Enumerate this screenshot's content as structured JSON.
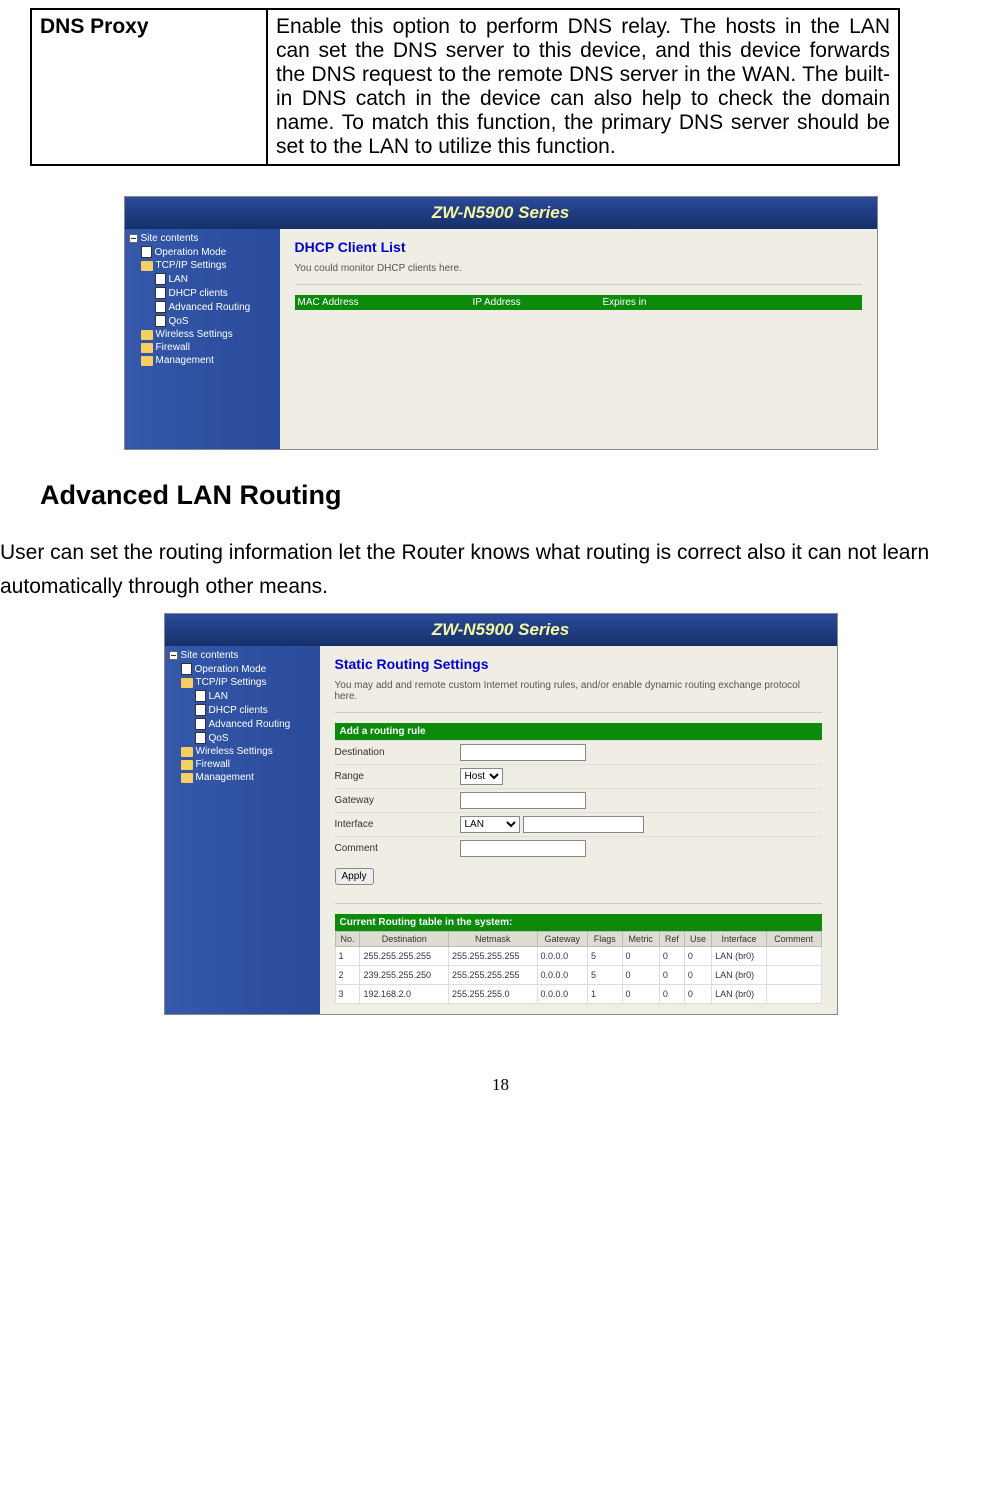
{
  "top_table": {
    "label": "DNS Proxy",
    "text": "Enable this option to perform DNS relay. The hosts in the LAN can set the DNS server to this device, and this device forwards the DNS request to the remote DNS server in the WAN. The built-in DNS catch in the device can also help to check the domain name. To match this function, the primary DNS server should be set to the LAN to utilize this function."
  },
  "screenshot1": {
    "series": "ZW-N5900 Series",
    "sidebar_title": "Site contents",
    "sidebar": {
      "operation_mode": "Operation Mode",
      "tcpip": "TCP/IP Settings",
      "lan": "LAN",
      "dhcp": "DHCP clients",
      "advanced_routing": "Advanced Routing",
      "qos": "QoS",
      "wireless": "Wireless Settings",
      "firewall": "Firewall",
      "management": "Management"
    },
    "content_title": "DHCP Client List",
    "content_sub": "You could monitor DHCP clients here.",
    "table_headers": {
      "mac": "MAC Address",
      "ip": "IP Address",
      "expires": "Expires in"
    }
  },
  "section_heading": "Advanced LAN Routing",
  "body_text": "User can set the routing information let the Router knows what routing is correct also it can not learn automatically through other means.",
  "screenshot2": {
    "series": "ZW-N5900 Series",
    "sidebar_title": "Site contents",
    "sidebar": {
      "operation_mode": "Operation Mode",
      "tcpip": "TCP/IP Settings",
      "lan": "LAN",
      "dhcp": "DHCP clients",
      "advanced_routing": "Advanced Routing",
      "qos": "QoS",
      "wireless": "Wireless Settings",
      "firewall": "Firewall",
      "management": "Management"
    },
    "content_title": "Static Routing Settings",
    "content_sub": "You may add and remote custom Internet routing rules, and/or enable dynamic routing exchange protocol here.",
    "banner_add": "Add a routing rule",
    "form": {
      "destination": "Destination",
      "range": "Range",
      "range_value": "Host",
      "gateway": "Gateway",
      "interface": "Interface",
      "interface_value": "LAN",
      "comment": "Comment"
    },
    "apply": "Apply",
    "banner_current": "Current Routing table in the system:",
    "rt_headers": {
      "no": "No.",
      "destination": "Destination",
      "netmask": "Netmask",
      "gateway": "Gateway",
      "flags": "Flags",
      "metric": "Metric",
      "ref": "Ref",
      "use": "Use",
      "interface": "Interface",
      "comment": "Comment"
    },
    "rt_rows": [
      {
        "no": "1",
        "destination": "255.255.255.255",
        "netmask": "255.255.255.255",
        "gateway": "0.0.0.0",
        "flags": "5",
        "metric": "0",
        "ref": "0",
        "use": "0",
        "interface": "LAN (br0)",
        "comment": ""
      },
      {
        "no": "2",
        "destination": "239.255.255.250",
        "netmask": "255.255.255.255",
        "gateway": "0.0.0.0",
        "flags": "5",
        "metric": "0",
        "ref": "0",
        "use": "0",
        "interface": "LAN (br0)",
        "comment": ""
      },
      {
        "no": "3",
        "destination": "192.168.2.0",
        "netmask": "255.255.255.0",
        "gateway": "0.0.0.0",
        "flags": "1",
        "metric": "0",
        "ref": "0",
        "use": "0",
        "interface": "LAN (br0)",
        "comment": ""
      }
    ]
  },
  "page_number": "18"
}
